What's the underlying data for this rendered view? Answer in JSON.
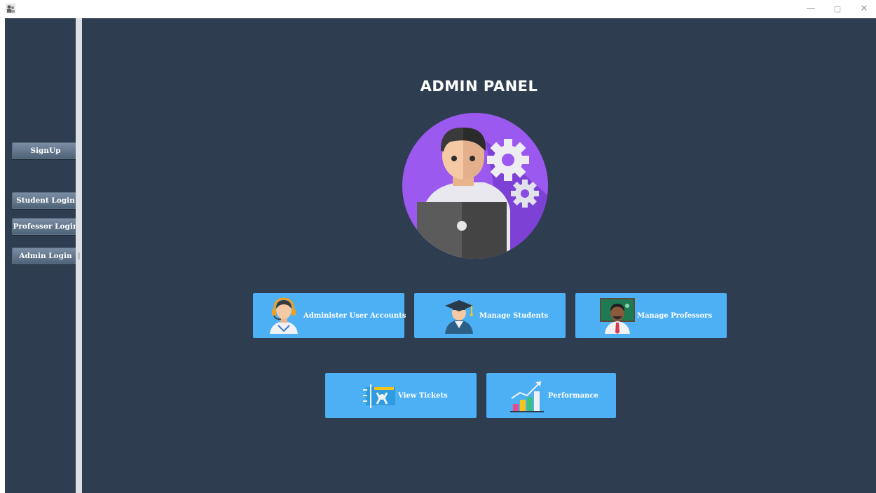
{
  "window": {
    "minimize_glyph": "—",
    "restore_glyph": "▢",
    "close_glyph": "✕"
  },
  "sidebar": {
    "buttons": [
      {
        "label": "SignUp"
      },
      {
        "label": "Student Login"
      },
      {
        "label": "Professor Login"
      },
      {
        "label": "Admin Login"
      }
    ]
  },
  "main": {
    "title": "ADMIN PANEL",
    "avatar_icon": "admin-with-gears-icon",
    "tiles": [
      {
        "label": "Administer User Accounts",
        "icon": "support-agent-icon"
      },
      {
        "label": "Manage Students",
        "icon": "graduate-student-icon"
      },
      {
        "label": "Manage Professors",
        "icon": "professor-board-icon"
      },
      {
        "label": "View Tickets",
        "icon": "ticket-tools-icon"
      },
      {
        "label": "Performance",
        "icon": "growth-chart-icon"
      }
    ]
  },
  "colors": {
    "background": "#2e3e50",
    "tile": "#4db0f5",
    "avatar_circle": "#9b59f0"
  }
}
